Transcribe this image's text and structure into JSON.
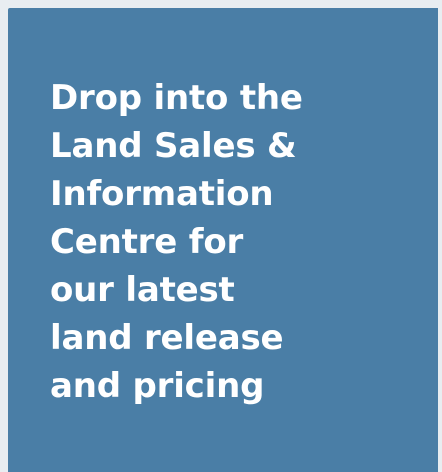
{
  "card": {
    "lines": [
      "Drop into the",
      "Land Sales &",
      "Information",
      "Centre for",
      "our latest",
      "land release",
      "and pricing"
    ],
    "background_color": "#4a7ea6",
    "text_color": "#ffffff"
  }
}
